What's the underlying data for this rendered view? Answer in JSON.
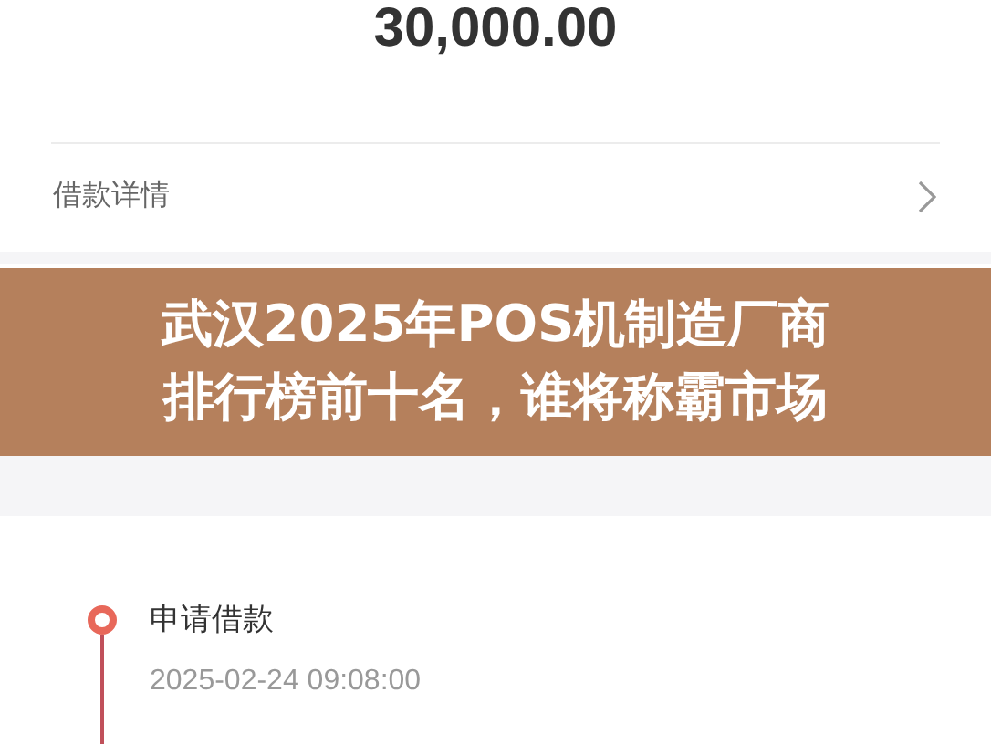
{
  "amount": "30,000.00",
  "detail_row": {
    "label": "借款详情"
  },
  "banner": {
    "lines": [
      "武汉2025年POS机制造厂商",
      "排行榜前十名，谁将称霸市场"
    ]
  },
  "timeline": [
    {
      "title": "申请借款",
      "time": "2025-02-24 09:08:00"
    }
  ]
}
